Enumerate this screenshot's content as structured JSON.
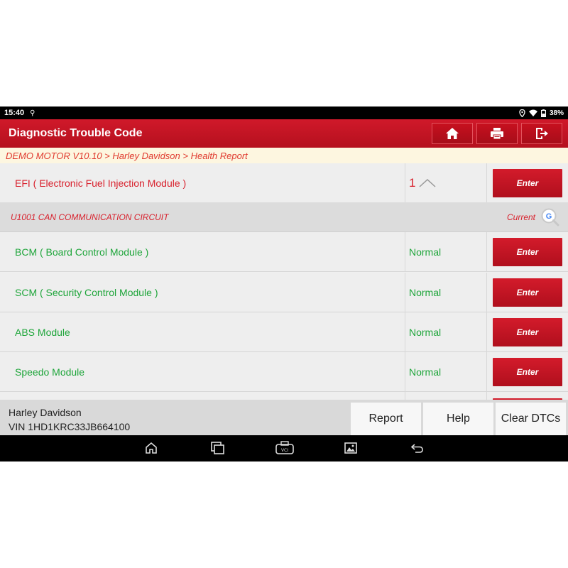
{
  "status_bar": {
    "time": "15:40",
    "battery": "38%"
  },
  "header": {
    "title": "Diagnostic Trouble Code"
  },
  "breadcrumb": "DEMO MOTOR V10.10 > Harley Davidson > Health Report",
  "modules": [
    {
      "name": "EFI ( Electronic Fuel Injection Module )",
      "status": "1",
      "action": "Enter"
    },
    {
      "name": "BCM ( Board Control Module )",
      "status": "Normal",
      "action": "Enter"
    },
    {
      "name": "SCM ( Security Control Module )",
      "status": "Normal",
      "action": "Enter"
    },
    {
      "name": "ABS Module",
      "status": "Normal",
      "action": "Enter"
    },
    {
      "name": "Speedo Module",
      "status": "Normal",
      "action": "Enter"
    }
  ],
  "dtc": {
    "code": "U1001 CAN COMMUNICATION CIRCUIT",
    "state": "Current"
  },
  "vehicle": {
    "make": "Harley Davidson",
    "vin": "VIN 1HD1KRC33JB664100"
  },
  "footer_buttons": {
    "report": "Report",
    "help": "Help",
    "clear": "Clear DTCs"
  },
  "colors": {
    "brand_red": "#c8141f",
    "fault_red": "#d8202c",
    "normal_green": "#1ea53a",
    "breadcrumb_bg": "#fdf6e0"
  }
}
